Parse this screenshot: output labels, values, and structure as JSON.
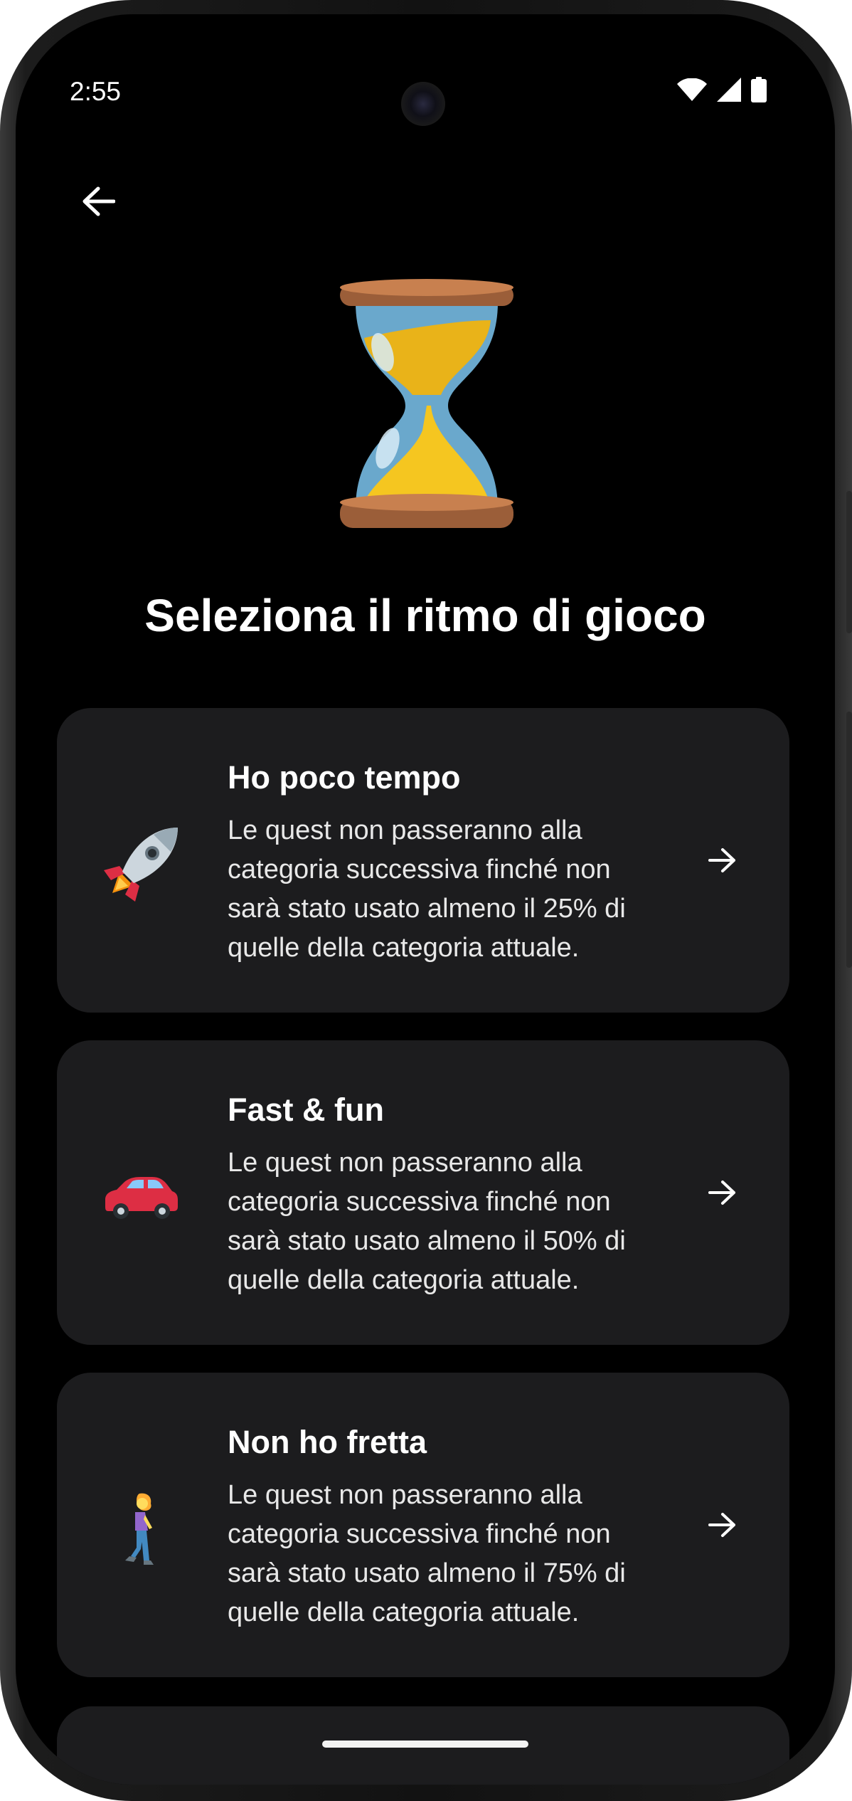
{
  "status_bar": {
    "time": "2:55"
  },
  "icons": {
    "back": "arrow-left-icon",
    "hero": "hourglass-icon",
    "wifi": "wifi-icon",
    "signal": "signal-icon",
    "battery": "battery-icon"
  },
  "title": "Seleziona il ritmo di gioco",
  "options": [
    {
      "title": "Ho poco tempo",
      "description": "Le quest non passeranno alla categoria successiva finché non sarà stato usato almeno il 25% di quelle della categoria attuale.",
      "icon": "rocket-icon"
    },
    {
      "title": "Fast & fun",
      "description": "Le quest non passeranno alla categoria successiva finché non sarà stato usato almeno il 50% di quelle della categoria attuale.",
      "icon": "car-icon"
    },
    {
      "title": "Non ho fretta",
      "description": "Le quest non passeranno alla categoria successiva finché non sarà stato usato almeno il 75% di quelle della categoria attuale.",
      "icon": "walking-woman-icon"
    }
  ],
  "colors": {
    "background": "#000000",
    "card": "#1c1c1e",
    "text": "#ffffff"
  }
}
